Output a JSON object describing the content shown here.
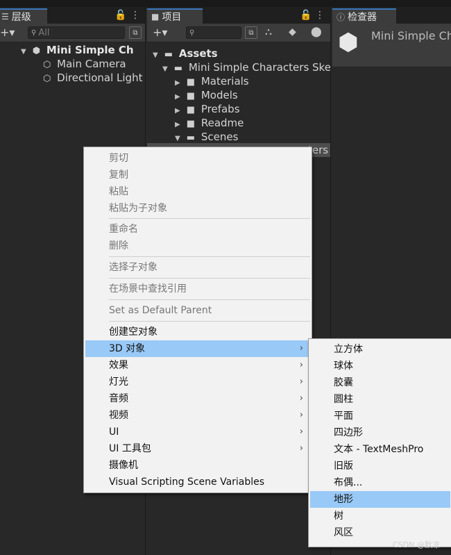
{
  "hierarchy": {
    "tab_label": "层级",
    "search_placeholder": "All",
    "scene_name": "Mini Simple Ch",
    "items": [
      "Main Camera",
      "Directional Light"
    ]
  },
  "project": {
    "tab_label": "项目",
    "assets": "Assets",
    "package": "Mini Simple Characters Ske",
    "folders": [
      "Materials",
      "Models",
      "Prefabs",
      "Readme",
      "Scenes"
    ],
    "selected_partial": "ters"
  },
  "inspector": {
    "tab_label": "检查器",
    "object_name": "Mini Simple Ch"
  },
  "context_menu": {
    "items": [
      {
        "label": "剪切",
        "disabled": true
      },
      {
        "label": "复制",
        "disabled": true
      },
      {
        "label": "粘贴",
        "disabled": true
      },
      {
        "label": "粘贴为子对象",
        "disabled": true
      },
      {
        "label": "重命名",
        "disabled": true
      },
      {
        "label": "删除",
        "disabled": true
      },
      {
        "label": "选择子对象",
        "disabled": true
      },
      {
        "label": "在场景中查找引用",
        "disabled": true
      },
      {
        "label": "Set as Default Parent",
        "disabled": true
      },
      {
        "label": "创建空对象",
        "disabled": false
      },
      {
        "label": "3D 对象",
        "disabled": false,
        "submenu": true,
        "highlighted": true
      },
      {
        "label": "效果",
        "disabled": false,
        "submenu": true
      },
      {
        "label": "灯光",
        "disabled": false,
        "submenu": true
      },
      {
        "label": "音频",
        "disabled": false,
        "submenu": true
      },
      {
        "label": "视频",
        "disabled": false,
        "submenu": true
      },
      {
        "label": "UI",
        "disabled": false,
        "submenu": true
      },
      {
        "label": "UI 工具包",
        "disabled": false,
        "submenu": true
      },
      {
        "label": "摄像机",
        "disabled": false
      },
      {
        "label": "Visual Scripting Scene Variables",
        "disabled": false
      }
    ]
  },
  "submenu_3d": {
    "items": [
      "立方体",
      "球体",
      "胶囊",
      "圆柱",
      "平面",
      "四边形",
      "文本 - TextMeshPro",
      "旧版",
      "布偶...",
      "地形",
      "树",
      "风区"
    ],
    "highlighted": "地形"
  },
  "watermark": "CSDN @默凉"
}
